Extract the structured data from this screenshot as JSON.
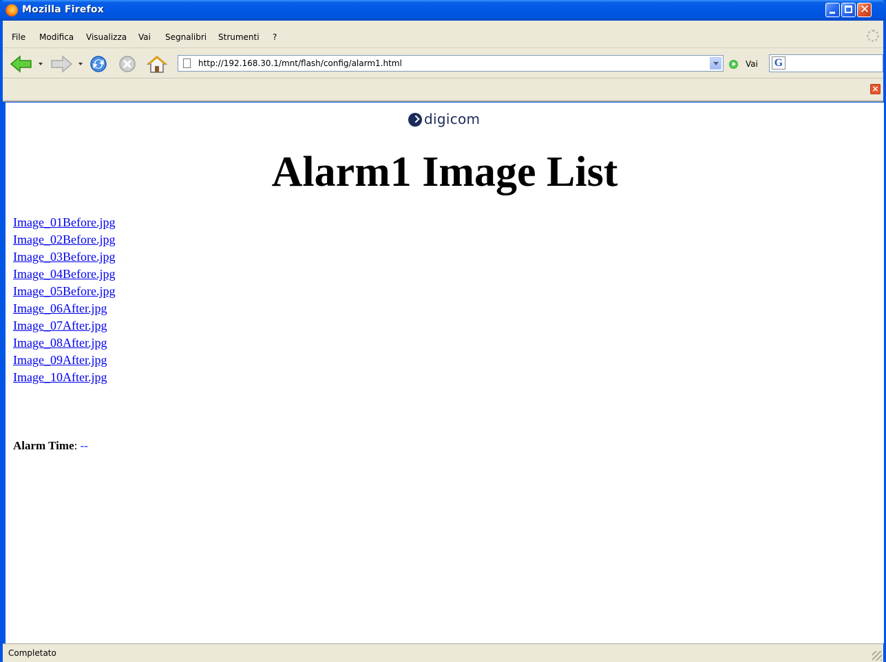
{
  "window": {
    "title": "Mozilla Firefox"
  },
  "menu": {
    "items": [
      "File",
      "Modifica",
      "Visualizza",
      "Vai",
      "Segnalibri",
      "Strumenti",
      "?"
    ]
  },
  "nav": {
    "url": "http://192.168.30.1/mnt/flash/config/alarm1.html",
    "go_label": "Vai",
    "search_value": ""
  },
  "page": {
    "logo_text": "digicom",
    "title": "Alarm1 Image List",
    "images": [
      "Image_01Before.jpg",
      "Image_02Before.jpg",
      "Image_03Before.jpg",
      "Image_04Before.jpg",
      "Image_05Before.jpg",
      "Image_06After.jpg",
      "Image_07After.jpg",
      "Image_08After.jpg",
      "Image_09After.jpg",
      "Image_10After.jpg"
    ],
    "alarm_time_label": "Alarm Time",
    "alarm_time_value": "--"
  },
  "status": {
    "text": "Completato"
  },
  "colors": {
    "link": "#0000ee",
    "titlebar": "#0058e6",
    "chrome": "#ece9d8"
  }
}
